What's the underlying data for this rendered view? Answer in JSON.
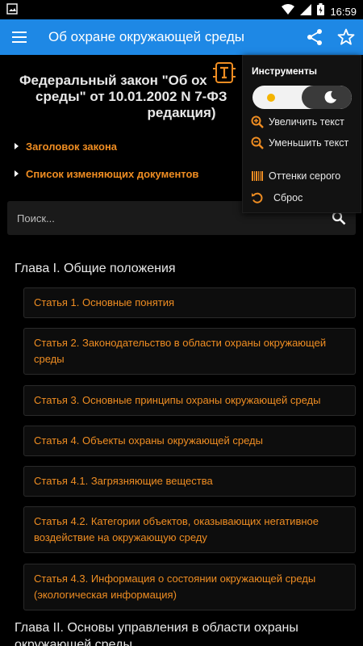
{
  "status_bar": {
    "time": "16:59"
  },
  "app_bar": {
    "title": "Об охране окружающей среды"
  },
  "document": {
    "title": "Федеральный закон \"Об охране окружающей среды\" от 10.01.2002 N 7-ФЗ (последняя редакция)",
    "title_line1": "Федеральный закон \"Об ох",
    "title_line2": "среды\" от 10.01.2002 N 7-ФЗ",
    "title_line3": "редакция)",
    "expanders": [
      "Заголовок закона",
      "Список изменяющих документов"
    ]
  },
  "search": {
    "placeholder": "Поиск..."
  },
  "chapters": [
    {
      "title": "Глава I. Общие положения",
      "articles": [
        "Статья 1. Основные понятия",
        "Статья 2. Законодательство в области охраны окружающей среды",
        "Статья 3. Основные принципы охраны окружающей среды",
        "Статья 4. Объекты охраны окружающей среды",
        "Статья 4.1. Загрязняющие вещества",
        "Статья 4.2. Категории объектов, оказывающих негативное воздействие на окружающую среду",
        "Статья 4.3. Информация о состоянии окружающей среды (экологическая информация)"
      ]
    },
    {
      "title": "Глава II. Основы управления в области охраны окружающей среды"
    }
  ],
  "tools_menu": {
    "title": "Инструменты",
    "theme_toggle": "dark",
    "items": [
      {
        "label": "Увеличить текст",
        "icon": "zoom-in-icon"
      },
      {
        "label": "Уменьшить текст",
        "icon": "zoom-out-icon"
      },
      {
        "label": "Оттенки серого",
        "icon": "barcode-icon"
      },
      {
        "label": "Сброс",
        "icon": "reset-icon"
      }
    ]
  },
  "colors": {
    "accent": "#ef8d22",
    "app_bar": "#1e88e5",
    "background": "#000000"
  }
}
